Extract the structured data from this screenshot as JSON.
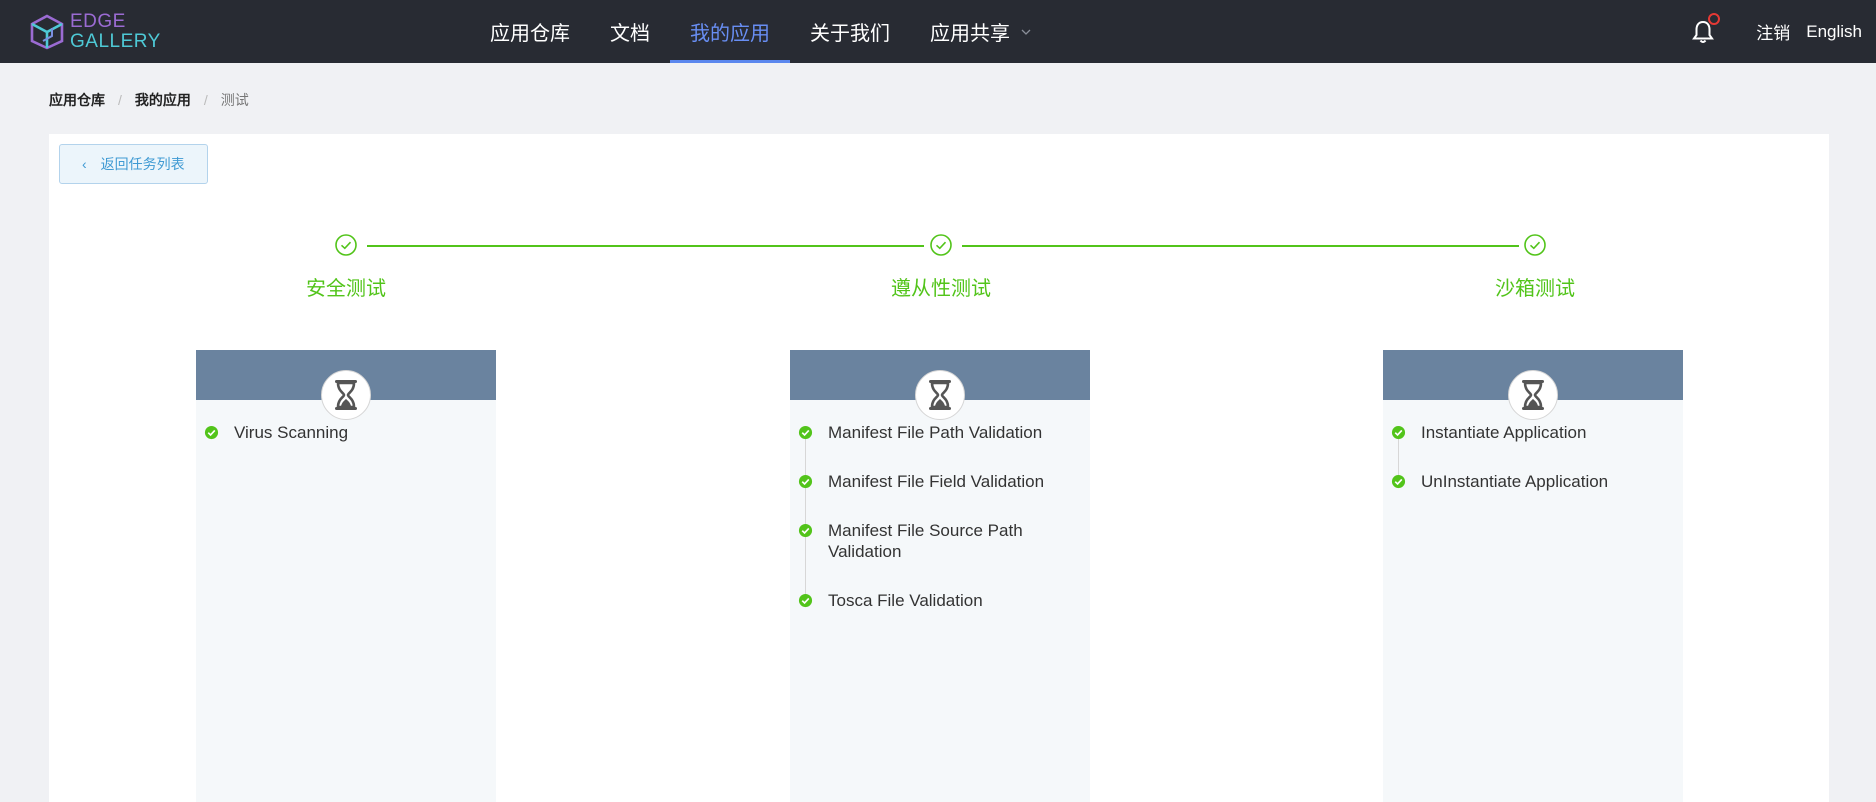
{
  "header": {
    "logo": {
      "line1": "EDGE",
      "line2": "GALLERY"
    },
    "nav": [
      {
        "label": "应用仓库",
        "active": false
      },
      {
        "label": "文档",
        "active": false
      },
      {
        "label": "我的应用",
        "active": true
      },
      {
        "label": "关于我们",
        "active": false
      },
      {
        "label": "应用共享",
        "active": false,
        "dropdown": true
      }
    ],
    "logout": "注销",
    "language": "English"
  },
  "breadcrumb": [
    "应用仓库",
    "我的应用",
    "测试"
  ],
  "back_button": "返回任务列表",
  "steps": [
    {
      "label": "安全测试",
      "status": "success"
    },
    {
      "label": "遵从性测试",
      "status": "success"
    },
    {
      "label": "沙箱测试",
      "status": "success"
    }
  ],
  "panels": [
    {
      "items": [
        "Virus Scanning"
      ]
    },
    {
      "items": [
        "Manifest File Path Validation",
        "Manifest File Field Validation",
        "Manifest File Source Path Validation",
        "Tosca File Validation"
      ]
    },
    {
      "items": [
        "Instantiate Application",
        "UnInstantiate Application"
      ]
    }
  ],
  "colors": {
    "header_bg": "#282b33",
    "nav_active": "#688ef3",
    "success": "#52c41a",
    "panel_head": "#6a839f",
    "back_button_text": "#3f9ad3"
  }
}
